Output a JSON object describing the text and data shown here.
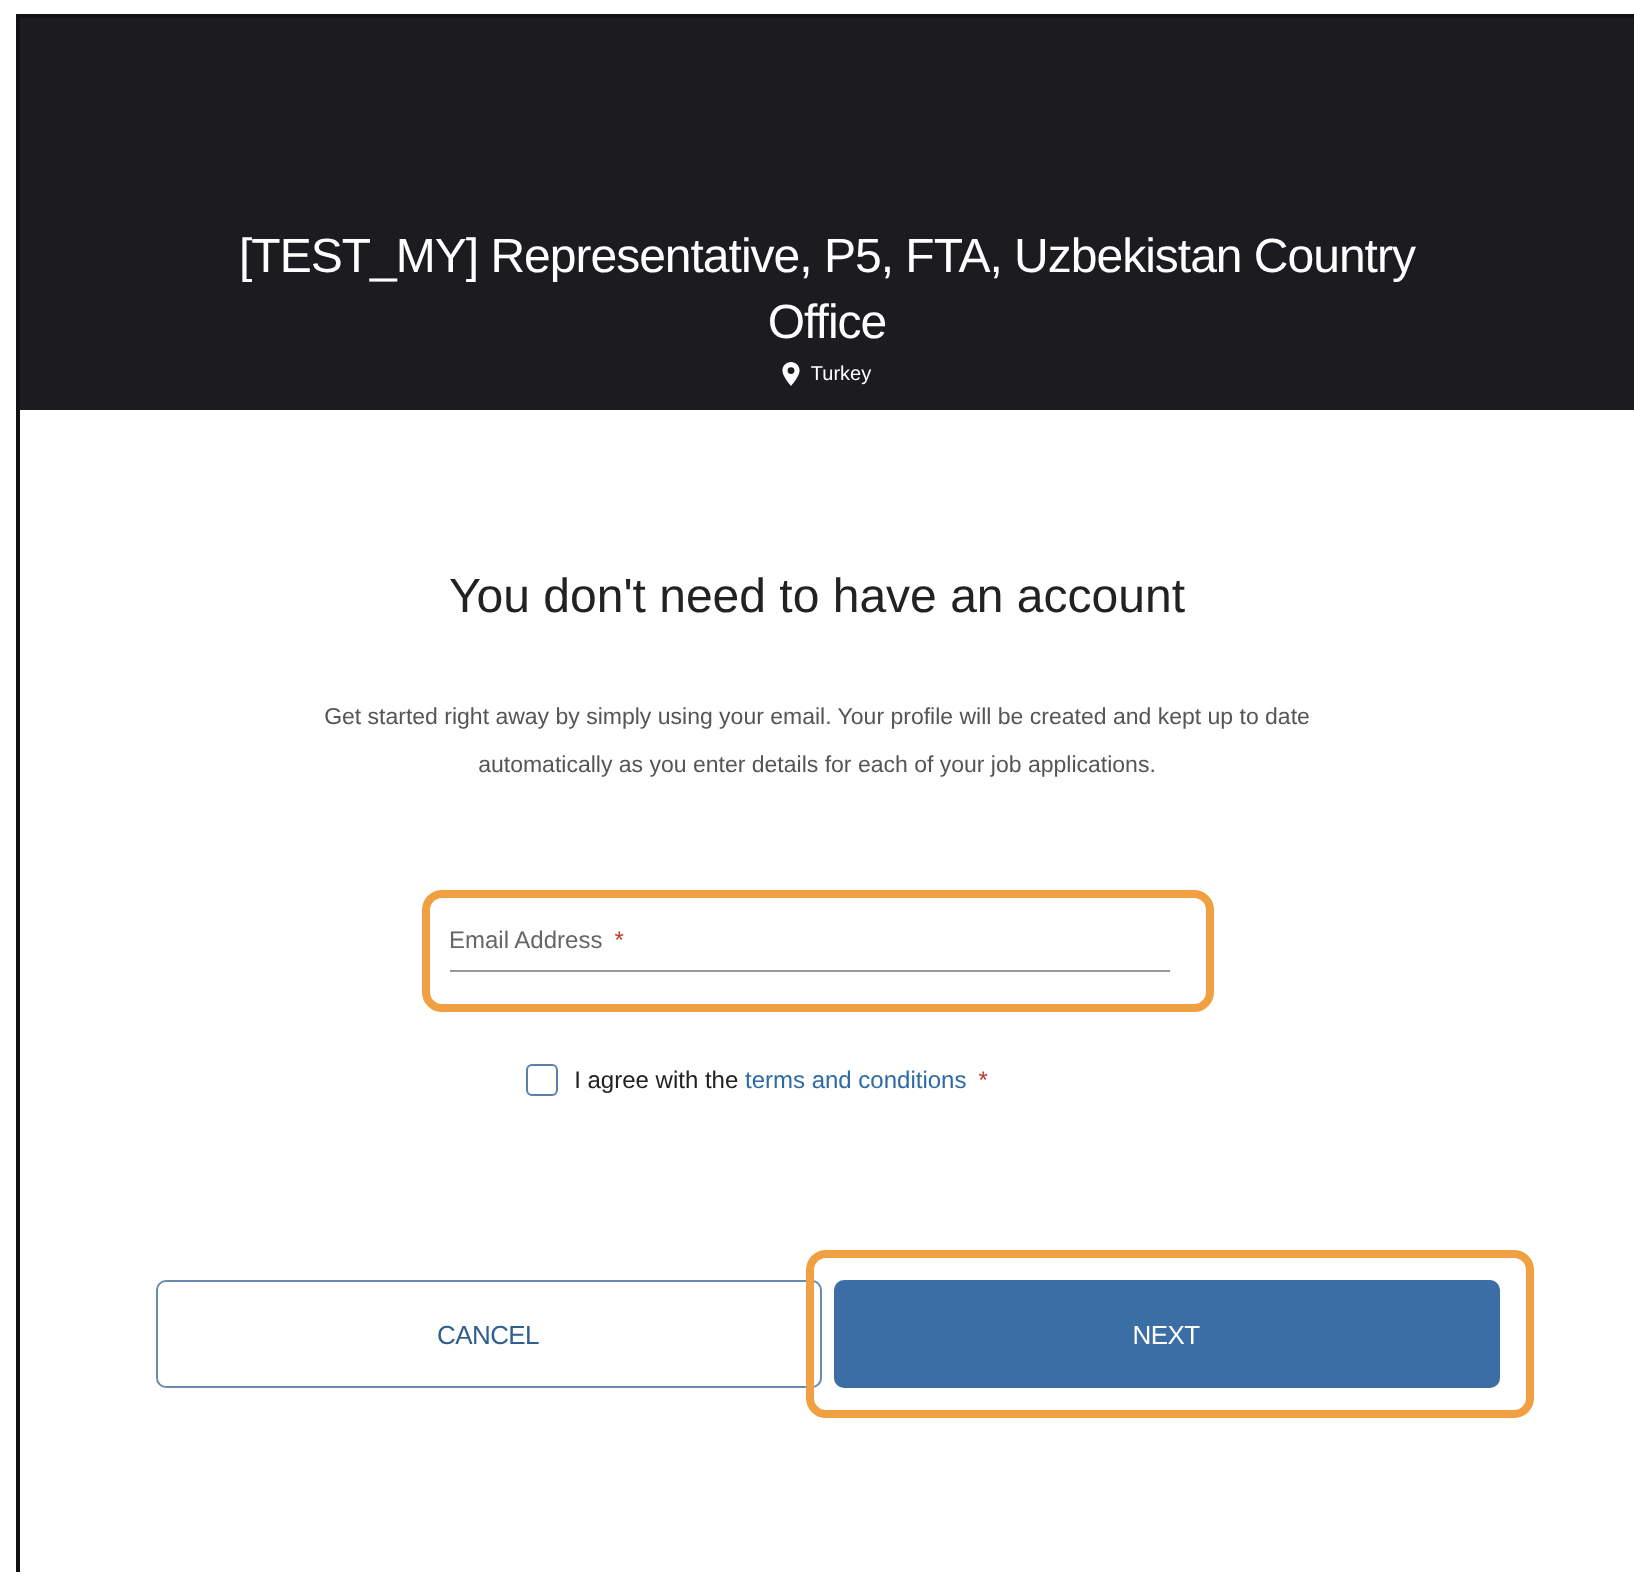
{
  "header": {
    "title": "[TEST_MY] Representative, P5, FTA, Uzbekistan Country Office",
    "location": "Turkey"
  },
  "heading": "You don't need to have an account",
  "intro": "Get started right away by simply using your email. Your profile will be created and kept up to date automatically as you enter details for each of your job applications.",
  "email_field": {
    "placeholder": "Email Address",
    "required_mark": "*",
    "highlighted": true
  },
  "agreement": {
    "checked": false,
    "text": "I agree with the",
    "link": "terms and conditions",
    "required_mark": "*"
  },
  "buttons": [
    {
      "label": "CANCEL",
      "kind": "secondary",
      "highlighted": false
    },
    {
      "label": "NEXT",
      "kind": "primary",
      "highlighted": true
    }
  ]
}
